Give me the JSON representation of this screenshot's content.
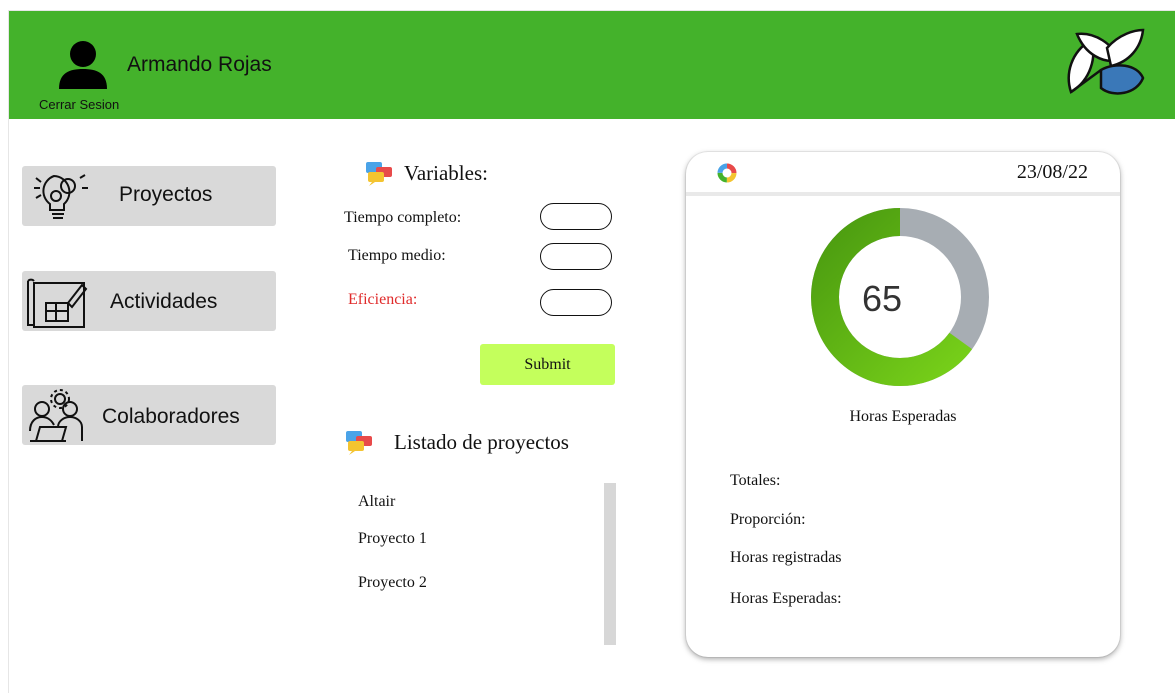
{
  "header": {
    "user_name": "Armando Rojas",
    "logout_label": "Cerrar Sesion",
    "color": "#44b22b"
  },
  "sidebar": {
    "items": [
      {
        "label": "Proyectos",
        "icon": "gear-bulb-icon"
      },
      {
        "label": "Actividades",
        "icon": "blueprint-icon"
      },
      {
        "label": "Colaboradores",
        "icon": "team-gear-icon"
      }
    ]
  },
  "variables": {
    "title": "Variables:",
    "fields": [
      {
        "label": "Tiempo completo:",
        "value": ""
      },
      {
        "label": "Tiempo medio:",
        "value": ""
      },
      {
        "label": "Eficiencia:",
        "value": ""
      }
    ],
    "submit_label": "Submit"
  },
  "projects": {
    "title": "Listado de proyectos",
    "items": [
      "Altair",
      "Proyecto 1",
      "Proyecto 2"
    ]
  },
  "card": {
    "date": "23/08/22",
    "donut_value": "65",
    "donut_fraction": 0.65,
    "caption": "Horas Esperadas",
    "stats": [
      "Totales:",
      "Proporción:",
      "Horas registradas",
      "Horas Esperadas:"
    ]
  }
}
